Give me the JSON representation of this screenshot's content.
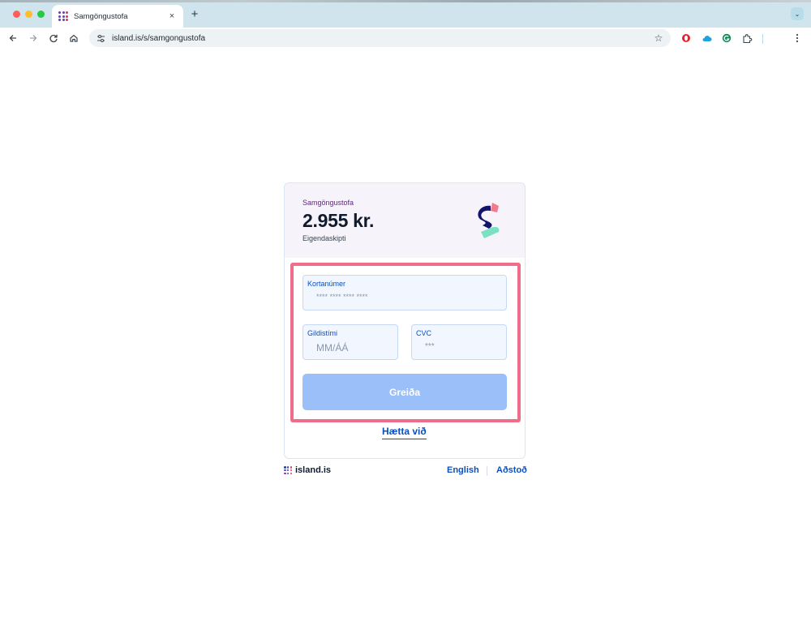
{
  "browser": {
    "tab_title": "Samgöngustofa",
    "tab_close": "×",
    "new_tab": "+",
    "url": "island.is/s/samgongustofa",
    "menu_glyph": "⌄"
  },
  "payment": {
    "merchant": "Samgöngustofa",
    "amount": "2.955 kr.",
    "description": "Eigendaskipti",
    "card_number_label": "Kortanúmer",
    "card_number_placeholder": "**** **** **** ****",
    "expiry_label": "Gildistími",
    "expiry_placeholder": "MM/ÁÁ",
    "cvc_label": "CVC",
    "cvc_placeholder": "***",
    "pay_button": "Greiða",
    "cancel_link": "Hætta við"
  },
  "footer": {
    "logo_text": "island.is",
    "language_link": "English",
    "help_link": "Aðstoð"
  },
  "colors": {
    "primary_blue": "#0b4fbf",
    "pay_button_disabled": "#9bbff9",
    "highlight_border": "#ef6d89",
    "header_background": "#f7f3fa"
  }
}
